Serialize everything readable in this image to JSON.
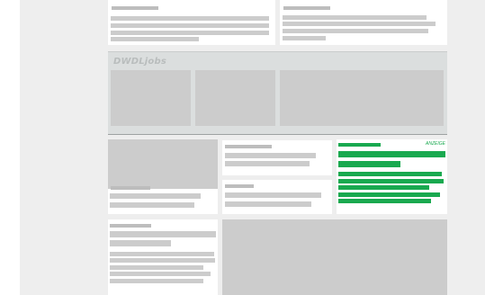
{
  "header_band": {
    "brand_text": "DWDLjobs"
  },
  "featured_panel": {
    "tag_text": "ANZEIGE"
  },
  "colors": {
    "page_background": "#eeeeee",
    "placeholder": "#cccccc",
    "accent_green": "#19a94f",
    "band": "#dbdede"
  }
}
